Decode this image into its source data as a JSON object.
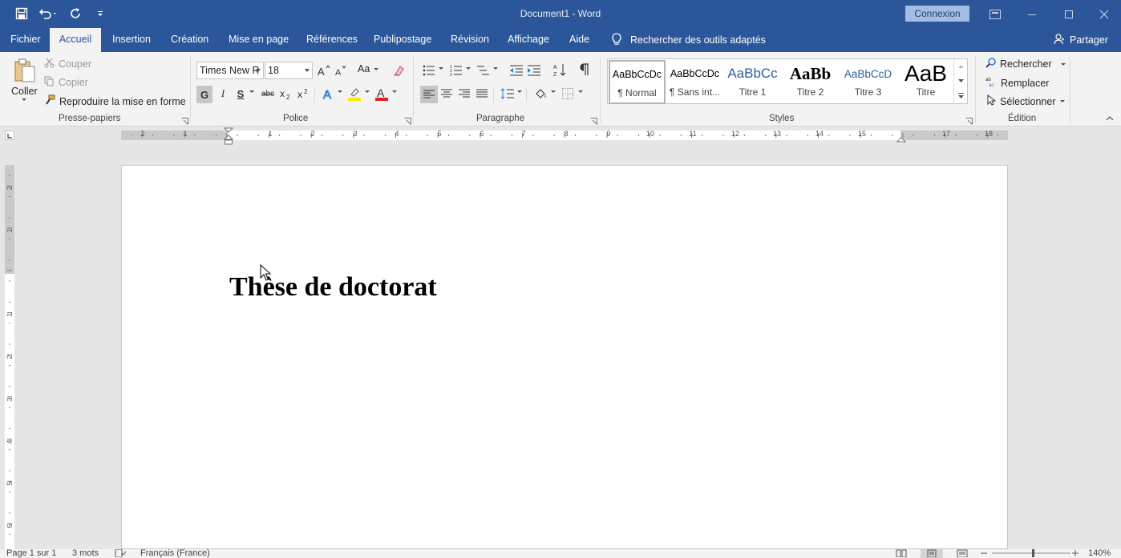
{
  "window": {
    "title": "Document1 - Word",
    "connexion_label": "Connexion"
  },
  "qat": {
    "save_icon": "save-icon",
    "undo_icon": "undo-icon",
    "redo_icon": "redo-icon",
    "customize_icon": "customize-qat-icon"
  },
  "tabs": [
    {
      "label": "Fichier"
    },
    {
      "label": "Accueil",
      "active": true
    },
    {
      "label": "Insertion"
    },
    {
      "label": "Création"
    },
    {
      "label": "Mise en page"
    },
    {
      "label": "Références"
    },
    {
      "label": "Publipostage"
    },
    {
      "label": "Révision"
    },
    {
      "label": "Affichage"
    },
    {
      "label": "Aide"
    }
  ],
  "tell_me": "Rechercher des outils adaptés",
  "share": "Partager",
  "clipboard": {
    "paste": "Coller",
    "cut": "Couper",
    "copy": "Copier",
    "format_painter": "Reproduire la mise en forme",
    "group": "Presse-papiers"
  },
  "font": {
    "name": "Times New R",
    "size": "18",
    "bold": "G",
    "italic": "I",
    "underline": "S",
    "strike": "abc",
    "case_label": "Aa",
    "group": "Police"
  },
  "paragraph": {
    "group": "Paragraphe"
  },
  "styles": {
    "items": [
      {
        "sample": "AaBbCcDc",
        "name": "¶ Normal",
        "selected": true
      },
      {
        "sample": "AaBbCcDc",
        "name": "¶ Sans int..."
      },
      {
        "sample": "AaBbCc",
        "name": "Titre 1"
      },
      {
        "sample": "AaBb",
        "name": "Titre 2"
      },
      {
        "sample": "AaBbCcD",
        "name": "Titre 3"
      },
      {
        "sample": "AaB",
        "name": "Titre"
      }
    ],
    "group": "Styles"
  },
  "editing": {
    "find": "Rechercher",
    "replace": "Remplacer",
    "select": "Sélectionner",
    "group": "Édition"
  },
  "ruler": {
    "numbers": [
      "2",
      "1",
      "1",
      "2",
      "3",
      "4",
      "5",
      "6",
      "7",
      "8",
      "9",
      "10",
      "11",
      "12",
      "13",
      "14",
      "15",
      "17",
      "18"
    ],
    "vnumbers": [
      "2",
      "1",
      "1",
      "2",
      "3",
      "4",
      "5",
      "6"
    ]
  },
  "document": {
    "heading": "Thèse de doctorat"
  },
  "status": {
    "page": "Page 1 sur 1",
    "words": "3 mots",
    "language": "Français (France)",
    "zoom": "140%"
  }
}
